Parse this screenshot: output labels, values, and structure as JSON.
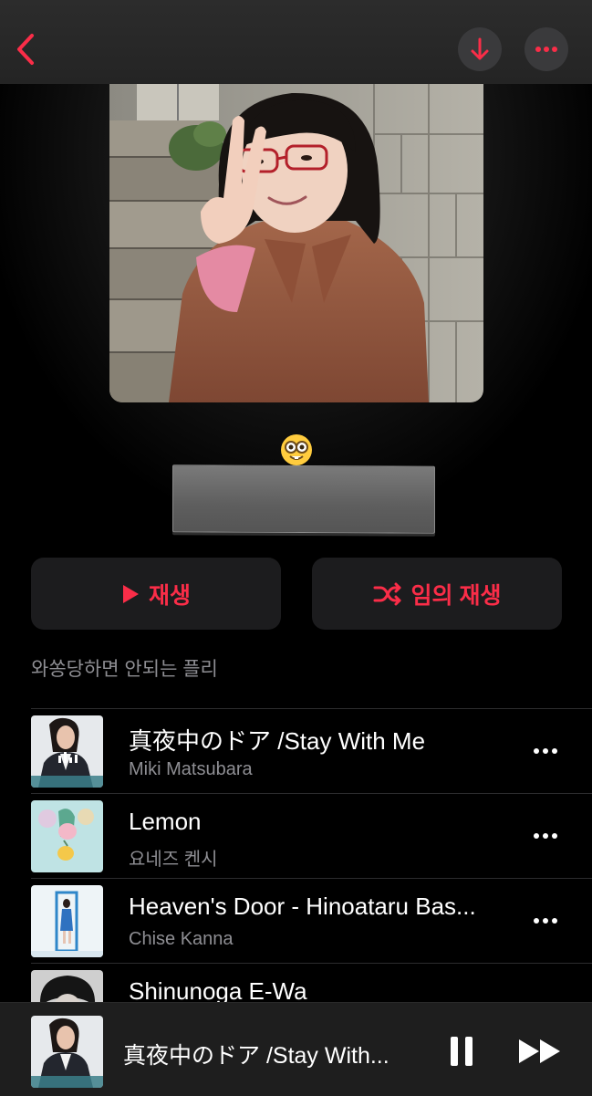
{
  "nav": {
    "back_icon": "chevron-left-icon",
    "download_icon": "arrow-down-icon",
    "more_icon": "ellipsis-icon"
  },
  "playlist": {
    "emoji": "🤓",
    "title": "",
    "description": "와쏭당하면 안되는 플리",
    "play_label": "재생",
    "shuffle_label": "임의 재생"
  },
  "tracks": [
    {
      "title": "真夜中のドア /Stay With Me",
      "artist": "Miki Matsubara",
      "now_playing": true
    },
    {
      "title": "Lemon",
      "artist": "요네즈 켄시",
      "now_playing": false
    },
    {
      "title": "Heaven's Door - Hinoataru Bas...",
      "artist": "Chise Kanna",
      "now_playing": false
    },
    {
      "title": "Shinunoga E-Wa",
      "artist": "",
      "now_playing": false
    }
  ],
  "mini_player": {
    "title": "真夜中のドア /Stay With...",
    "pause_icon": "pause-icon",
    "forward_icon": "fast-forward-icon"
  },
  "colors": {
    "accent": "#fa2d48",
    "background": "#000000",
    "secondary_text": "#8e8e93",
    "button_bg": "#1c1c1e"
  }
}
